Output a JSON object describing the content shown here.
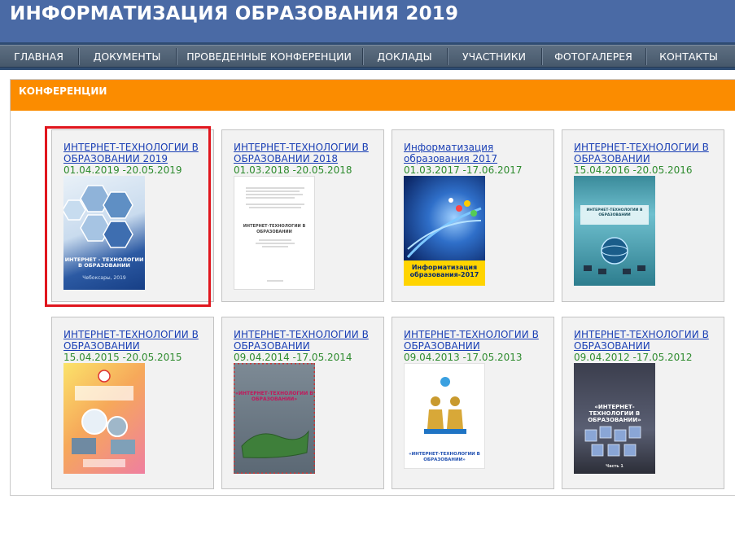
{
  "header": {
    "title": "ИНФОРМАТИЗАЦИЯ ОБРАЗОВАНИЯ 2019"
  },
  "nav": {
    "items": [
      {
        "label": "ГЛАВНАЯ"
      },
      {
        "label": "ДОКУМЕНТЫ"
      },
      {
        "label": "ПРОВЕДЕННЫЕ КОНФЕРЕНЦИИ"
      },
      {
        "label": "ДОКЛАДЫ"
      },
      {
        "label": "УЧАСТНИКИ"
      },
      {
        "label": "ФОТОГАЛЕРЕЯ"
      },
      {
        "label": "КОНТАКТЫ"
      }
    ]
  },
  "panel": {
    "title": "КОНФЕРЕНЦИИ"
  },
  "conferences": [
    {
      "title": "ИНТЕРНЕТ-ТЕХНОЛОГИИ В ОБРАЗОВАНИИ 2019",
      "dates": "01.04.2019 -20.05.2019",
      "cover_text": "ИНТЕРНЕТ - ТЕХНОЛОГИИ В ОБРАЗОВАНИИ",
      "cover_sub": "Чебоксары, 2019"
    },
    {
      "title": "ИНТЕРНЕТ-ТЕХНОЛОГИИ В ОБРАЗОВАНИИ 2018",
      "dates": "01.03.2018 -20.05.2018",
      "cover_text": "ИНТЕРНЕТ-ТЕХНОЛОГИИ В ОБРАЗОВАНИИ",
      "cover_sub": ""
    },
    {
      "title": "Информатизация образования 2017",
      "dates": "01.03.2017 -17.06.2017",
      "cover_text": "Информатизация образования-2017",
      "cover_sub": ""
    },
    {
      "title": "ИНТЕРНЕТ-ТЕХНОЛОГИИ В ОБРАЗОВАНИИ",
      "dates": "15.04.2016 -20.05.2016",
      "cover_text": "ИНТЕРНЕТ-ТЕХНОЛОГИИ В ОБРАЗОВАНИИ",
      "cover_sub": ""
    },
    {
      "title": "ИНТЕРНЕТ-ТЕХНОЛОГИИ В ОБРАЗОВАНИИ",
      "dates": "15.04.2015 -20.05.2015",
      "cover_text": "",
      "cover_sub": ""
    },
    {
      "title": "ИНТЕРНЕТ-ТЕХНОЛОГИИ В ОБРАЗОВАНИИ",
      "dates": "09.04.2014 -17.05.2014",
      "cover_text": "«ИНТЕРНЕТ-ТЕХНОЛОГИИ В ОБРАЗОВАНИИ»",
      "cover_sub": ""
    },
    {
      "title": "ИНТЕРНЕТ-ТЕХНОЛОГИИ В ОБРАЗОВАНИИ",
      "dates": "09.04.2013 -17.05.2013",
      "cover_text": "«ИНТЕРНЕТ-ТЕХНОЛОГИИ В ОБРАЗОВАНИИ»",
      "cover_sub": ""
    },
    {
      "title": "ИНТЕРНЕТ-ТЕХНОЛОГИИ В ОБРАЗОВАНИИ",
      "dates": "09.04.2012 -17.05.2012",
      "cover_text": "«ИНТЕРНЕТ-ТЕХНОЛОГИИ В ОБРАЗОВАНИИ»",
      "cover_sub": "Часть 1"
    }
  ],
  "colors": {
    "header_bg": "#4a6aa5",
    "panel_header": "#fb8c00",
    "link": "#1a3fb5",
    "date": "#2e8b2e",
    "highlight": "#e0161e"
  }
}
